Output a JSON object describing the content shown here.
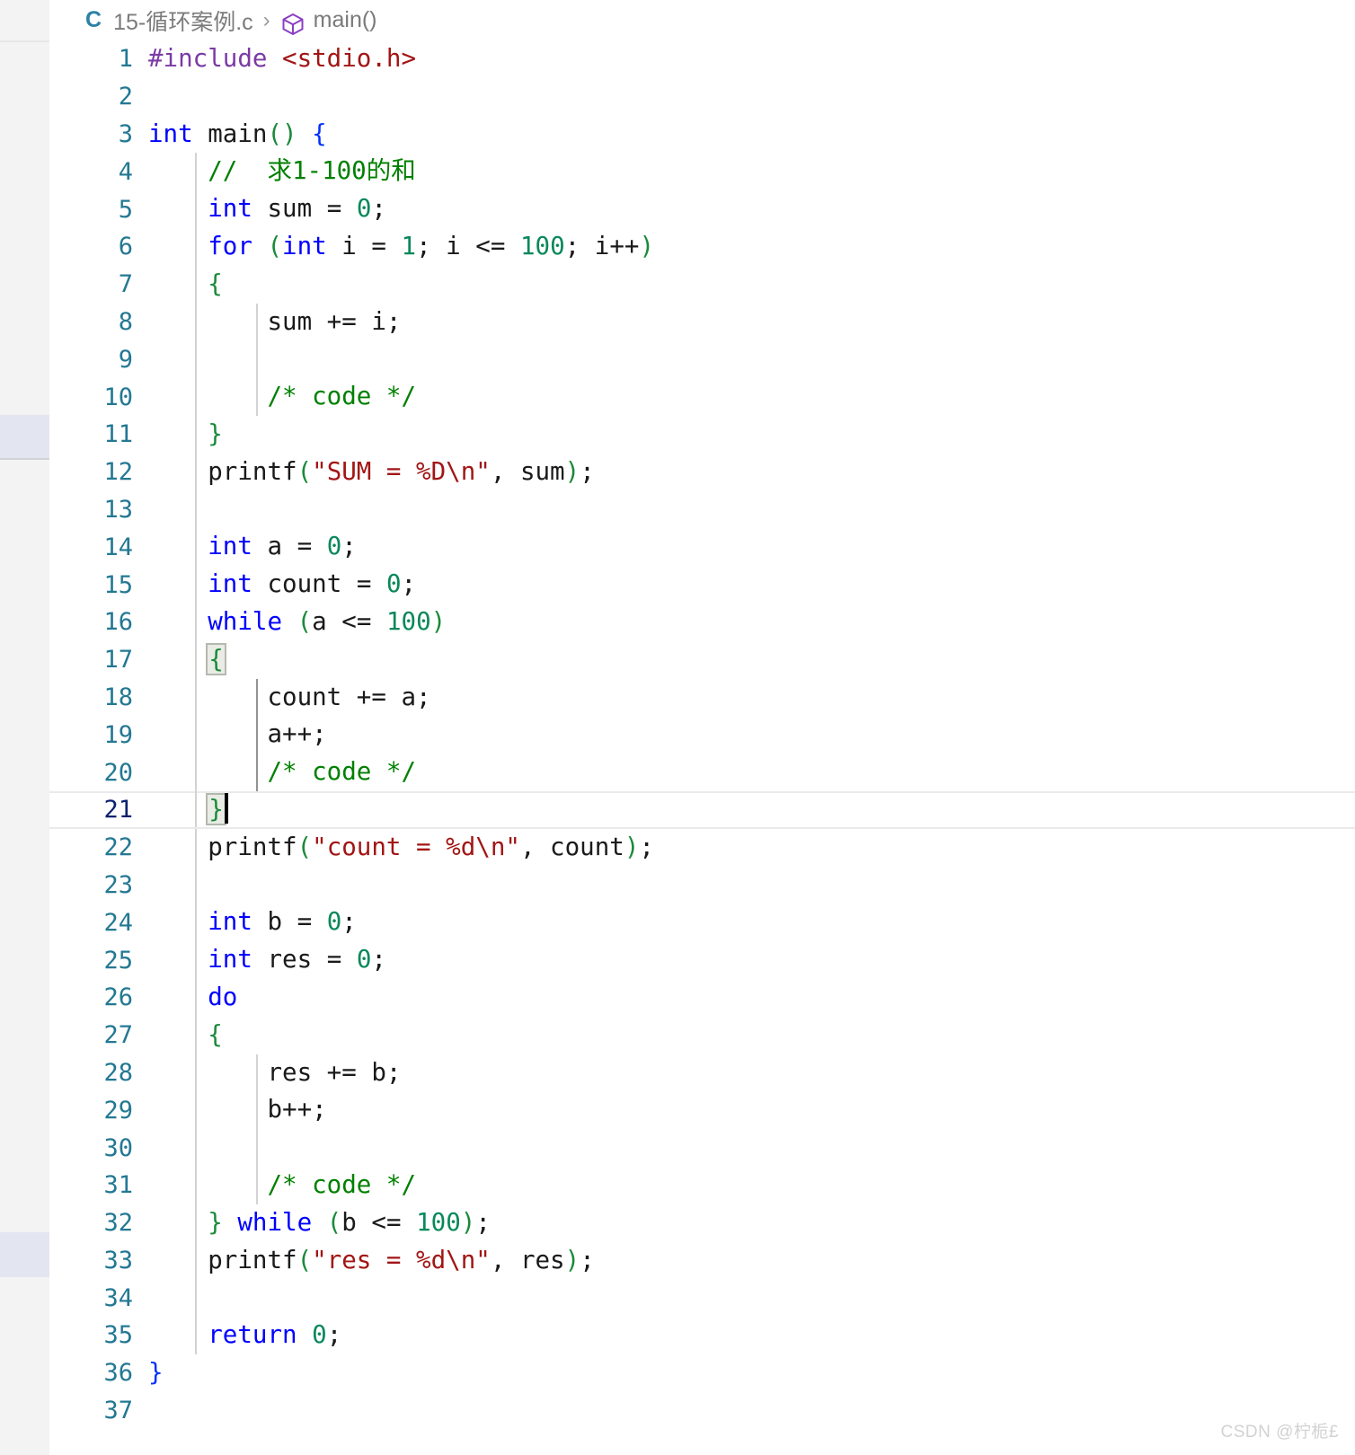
{
  "breadcrumb": {
    "language_icon": "c-file-icon",
    "language_label": "C",
    "file_name": "15-循环案例.c",
    "separator": "›",
    "symbol_icon": "cube-symbol-icon",
    "symbol_name": "main()"
  },
  "editor": {
    "active_line": 21,
    "cursor_line": 21,
    "total_visible_lines": 37,
    "colors": {
      "background": "#ffffff",
      "line_number": "#237893",
      "active_line_number": "#0b216f",
      "keyword": "#0000ff",
      "number": "#09885a",
      "string": "#a21515",
      "comment": "#008000",
      "preprocessor": "#7b3aa6",
      "punctuation": "#1a8a3a",
      "plain_text": "#1a1a1a",
      "brace_blue": "#0431fa",
      "indent_guide": "#d3d3d3",
      "active_indent_guide": "#939393",
      "active_line_border": "#eaeaea",
      "bracket_match_bg": "#e8ece4",
      "overview_mark": "#e3e5f0",
      "activity_bar": "#f3f3f3"
    },
    "lines": [
      {
        "n": 1,
        "guides": [],
        "tokens": [
          {
            "t": "#include",
            "c": "pre"
          },
          {
            "t": " ",
            "c": "plain"
          },
          {
            "t": "<stdio.h>",
            "c": "inc"
          }
        ]
      },
      {
        "n": 2,
        "guides": [],
        "tokens": []
      },
      {
        "n": 3,
        "guides": [],
        "tokens": [
          {
            "t": "int",
            "c": "kw"
          },
          {
            "t": " main",
            "c": "plain"
          },
          {
            "t": "()",
            "c": "pun"
          },
          {
            "t": " ",
            "c": "plain"
          },
          {
            "t": "{",
            "c": "brace_blue"
          }
        ]
      },
      {
        "n": 4,
        "guides": [
          "g1"
        ],
        "tokens": [
          {
            "t": "    ",
            "c": "plain"
          },
          {
            "t": "//  求1-100的和",
            "c": "cmt"
          }
        ]
      },
      {
        "n": 5,
        "guides": [
          "g1"
        ],
        "tokens": [
          {
            "t": "    ",
            "c": "plain"
          },
          {
            "t": "int",
            "c": "kw"
          },
          {
            "t": " sum ",
            "c": "plain"
          },
          {
            "t": "=",
            "c": "plain"
          },
          {
            "t": " ",
            "c": "plain"
          },
          {
            "t": "0",
            "c": "num"
          },
          {
            "t": ";",
            "c": "plain"
          }
        ]
      },
      {
        "n": 6,
        "guides": [
          "g1"
        ],
        "tokens": [
          {
            "t": "    ",
            "c": "plain"
          },
          {
            "t": "for",
            "c": "kw"
          },
          {
            "t": " ",
            "c": "plain"
          },
          {
            "t": "(",
            "c": "pun"
          },
          {
            "t": "int",
            "c": "kw"
          },
          {
            "t": " i ",
            "c": "plain"
          },
          {
            "t": "=",
            "c": "plain"
          },
          {
            "t": " ",
            "c": "plain"
          },
          {
            "t": "1",
            "c": "num"
          },
          {
            "t": "; i ",
            "c": "plain"
          },
          {
            "t": "<=",
            "c": "plain"
          },
          {
            "t": " ",
            "c": "plain"
          },
          {
            "t": "100",
            "c": "num"
          },
          {
            "t": "; i++",
            "c": "plain"
          },
          {
            "t": ")",
            "c": "pun"
          }
        ]
      },
      {
        "n": 7,
        "guides": [
          "g1"
        ],
        "tokens": [
          {
            "t": "    ",
            "c": "plain"
          },
          {
            "t": "{",
            "c": "pun"
          }
        ]
      },
      {
        "n": 8,
        "guides": [
          "g1",
          "g2"
        ],
        "tokens": [
          {
            "t": "        sum += i;",
            "c": "plain"
          }
        ]
      },
      {
        "n": 9,
        "guides": [
          "g1",
          "g2"
        ],
        "tokens": []
      },
      {
        "n": 10,
        "guides": [
          "g1",
          "g2"
        ],
        "tokens": [
          {
            "t": "        ",
            "c": "plain"
          },
          {
            "t": "/* code */",
            "c": "cmt"
          }
        ]
      },
      {
        "n": 11,
        "guides": [
          "g1"
        ],
        "tokens": [
          {
            "t": "    ",
            "c": "plain"
          },
          {
            "t": "}",
            "c": "pun"
          }
        ]
      },
      {
        "n": 12,
        "guides": [
          "g1"
        ],
        "tokens": [
          {
            "t": "    printf",
            "c": "plain"
          },
          {
            "t": "(",
            "c": "pun"
          },
          {
            "t": "\"SUM = %D\\n\"",
            "c": "str"
          },
          {
            "t": ", sum",
            "c": "plain"
          },
          {
            "t": ")",
            "c": "pun"
          },
          {
            "t": ";",
            "c": "plain"
          }
        ]
      },
      {
        "n": 13,
        "guides": [
          "g1"
        ],
        "tokens": []
      },
      {
        "n": 14,
        "guides": [
          "g1"
        ],
        "tokens": [
          {
            "t": "    ",
            "c": "plain"
          },
          {
            "t": "int",
            "c": "kw"
          },
          {
            "t": " a ",
            "c": "plain"
          },
          {
            "t": "=",
            "c": "plain"
          },
          {
            "t": " ",
            "c": "plain"
          },
          {
            "t": "0",
            "c": "num"
          },
          {
            "t": ";",
            "c": "plain"
          }
        ]
      },
      {
        "n": 15,
        "guides": [
          "g1"
        ],
        "tokens": [
          {
            "t": "    ",
            "c": "plain"
          },
          {
            "t": "int",
            "c": "kw"
          },
          {
            "t": " count ",
            "c": "plain"
          },
          {
            "t": "=",
            "c": "plain"
          },
          {
            "t": " ",
            "c": "plain"
          },
          {
            "t": "0",
            "c": "num"
          },
          {
            "t": ";",
            "c": "plain"
          }
        ]
      },
      {
        "n": 16,
        "guides": [
          "g1"
        ],
        "tokens": [
          {
            "t": "    ",
            "c": "plain"
          },
          {
            "t": "while",
            "c": "kw"
          },
          {
            "t": " ",
            "c": "plain"
          },
          {
            "t": "(",
            "c": "pun"
          },
          {
            "t": "a ",
            "c": "plain"
          },
          {
            "t": "<=",
            "c": "plain"
          },
          {
            "t": " ",
            "c": "plain"
          },
          {
            "t": "100",
            "c": "num"
          },
          {
            "t": ")",
            "c": "pun"
          }
        ]
      },
      {
        "n": 17,
        "guides": [
          "g1"
        ],
        "bracket_open": true,
        "tokens": [
          {
            "t": "    ",
            "c": "plain"
          },
          {
            "t": "{",
            "c": "pun",
            "match": true
          }
        ]
      },
      {
        "n": 18,
        "guides": [
          "g1",
          "g2a"
        ],
        "tokens": [
          {
            "t": "        count += a;",
            "c": "plain"
          }
        ]
      },
      {
        "n": 19,
        "guides": [
          "g1",
          "g2a"
        ],
        "tokens": [
          {
            "t": "        a++;",
            "c": "plain"
          }
        ]
      },
      {
        "n": 20,
        "guides": [
          "g1",
          "g2a"
        ],
        "tokens": [
          {
            "t": "        ",
            "c": "plain"
          },
          {
            "t": "/* code */",
            "c": "cmt"
          }
        ]
      },
      {
        "n": 21,
        "guides": [
          "g1"
        ],
        "active": true,
        "bracket_close": true,
        "cursor": true,
        "tokens": [
          {
            "t": "    ",
            "c": "plain"
          },
          {
            "t": "}",
            "c": "pun",
            "match": true
          }
        ]
      },
      {
        "n": 22,
        "guides": [
          "g1"
        ],
        "tokens": [
          {
            "t": "    printf",
            "c": "plain"
          },
          {
            "t": "(",
            "c": "pun"
          },
          {
            "t": "\"count = %d\\n\"",
            "c": "str"
          },
          {
            "t": ", count",
            "c": "plain"
          },
          {
            "t": ")",
            "c": "pun"
          },
          {
            "t": ";",
            "c": "plain"
          }
        ]
      },
      {
        "n": 23,
        "guides": [
          "g1"
        ],
        "tokens": []
      },
      {
        "n": 24,
        "guides": [
          "g1"
        ],
        "tokens": [
          {
            "t": "    ",
            "c": "plain"
          },
          {
            "t": "int",
            "c": "kw"
          },
          {
            "t": " b ",
            "c": "plain"
          },
          {
            "t": "=",
            "c": "plain"
          },
          {
            "t": " ",
            "c": "plain"
          },
          {
            "t": "0",
            "c": "num"
          },
          {
            "t": ";",
            "c": "plain"
          }
        ]
      },
      {
        "n": 25,
        "guides": [
          "g1"
        ],
        "tokens": [
          {
            "t": "    ",
            "c": "plain"
          },
          {
            "t": "int",
            "c": "kw"
          },
          {
            "t": " res ",
            "c": "plain"
          },
          {
            "t": "=",
            "c": "plain"
          },
          {
            "t": " ",
            "c": "plain"
          },
          {
            "t": "0",
            "c": "num"
          },
          {
            "t": ";",
            "c": "plain"
          }
        ]
      },
      {
        "n": 26,
        "guides": [
          "g1"
        ],
        "tokens": [
          {
            "t": "    ",
            "c": "plain"
          },
          {
            "t": "do",
            "c": "kw"
          }
        ]
      },
      {
        "n": 27,
        "guides": [
          "g1"
        ],
        "tokens": [
          {
            "t": "    ",
            "c": "plain"
          },
          {
            "t": "{",
            "c": "pun"
          }
        ]
      },
      {
        "n": 28,
        "guides": [
          "g1",
          "g2"
        ],
        "tokens": [
          {
            "t": "        res += b;",
            "c": "plain"
          }
        ]
      },
      {
        "n": 29,
        "guides": [
          "g1",
          "g2"
        ],
        "tokens": [
          {
            "t": "        b++;",
            "c": "plain"
          }
        ]
      },
      {
        "n": 30,
        "guides": [
          "g1",
          "g2"
        ],
        "tokens": []
      },
      {
        "n": 31,
        "guides": [
          "g1",
          "g2"
        ],
        "tokens": [
          {
            "t": "        ",
            "c": "plain"
          },
          {
            "t": "/* code */",
            "c": "cmt"
          }
        ]
      },
      {
        "n": 32,
        "guides": [
          "g1"
        ],
        "tokens": [
          {
            "t": "    ",
            "c": "plain"
          },
          {
            "t": "}",
            "c": "pun"
          },
          {
            "t": " ",
            "c": "plain"
          },
          {
            "t": "while",
            "c": "kw"
          },
          {
            "t": " ",
            "c": "plain"
          },
          {
            "t": "(",
            "c": "pun"
          },
          {
            "t": "b ",
            "c": "plain"
          },
          {
            "t": "<=",
            "c": "plain"
          },
          {
            "t": " ",
            "c": "plain"
          },
          {
            "t": "100",
            "c": "num"
          },
          {
            "t": ")",
            "c": "pun"
          },
          {
            "t": ";",
            "c": "plain"
          }
        ]
      },
      {
        "n": 33,
        "guides": [
          "g1"
        ],
        "tokens": [
          {
            "t": "    printf",
            "c": "plain"
          },
          {
            "t": "(",
            "c": "pun"
          },
          {
            "t": "\"res = %d\\n\"",
            "c": "str"
          },
          {
            "t": ", res",
            "c": "plain"
          },
          {
            "t": ")",
            "c": "pun"
          },
          {
            "t": ";",
            "c": "plain"
          }
        ]
      },
      {
        "n": 34,
        "guides": [
          "g1"
        ],
        "tokens": []
      },
      {
        "n": 35,
        "guides": [
          "g1"
        ],
        "tokens": [
          {
            "t": "    ",
            "c": "plain"
          },
          {
            "t": "return",
            "c": "kw"
          },
          {
            "t": " ",
            "c": "plain"
          },
          {
            "t": "0",
            "c": "num"
          },
          {
            "t": ";",
            "c": "plain"
          }
        ]
      },
      {
        "n": 36,
        "guides": [],
        "tokens": [
          {
            "t": "}",
            "c": "brace_blue"
          }
        ]
      },
      {
        "n": 37,
        "guides": [],
        "tokens": []
      }
    ]
  },
  "watermark": {
    "text": "CSDN @柠栀£"
  }
}
